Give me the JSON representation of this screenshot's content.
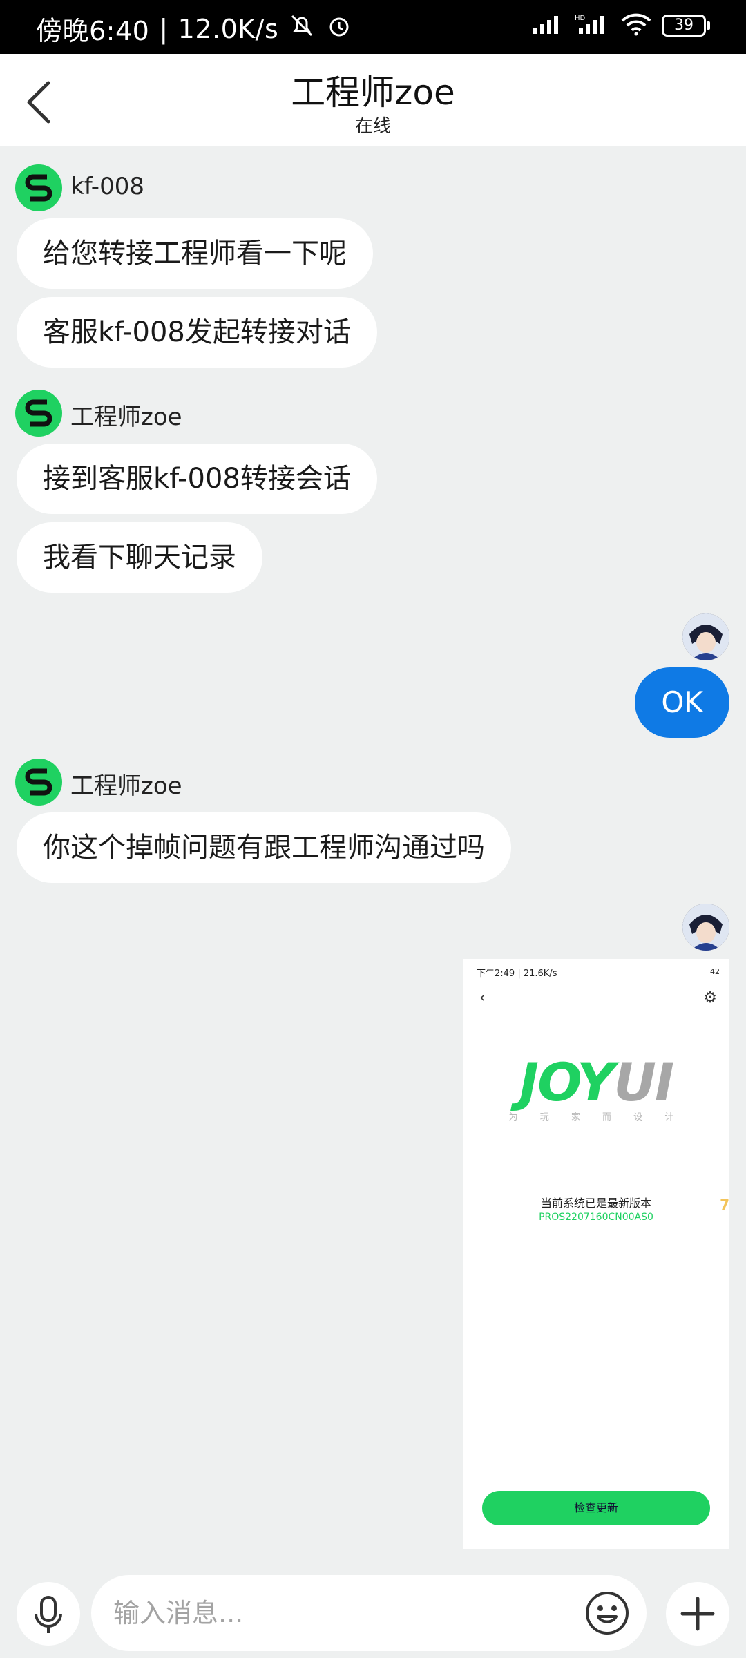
{
  "status_bar": {
    "time": "傍晚6:40",
    "net_speed": "12.0K/s",
    "battery": "39"
  },
  "header": {
    "title": "工程师zoe",
    "status": "在线"
  },
  "messages": [
    {
      "sender": "kf-008",
      "text": "给您转接工程师看一下呢"
    },
    {
      "text": "客服kf-008发起转接对话"
    },
    {
      "sender": "工程师zoe",
      "text": "接到客服kf-008转接会话"
    },
    {
      "text": "我看下聊天记录"
    },
    {
      "text": "OK"
    },
    {
      "sender": "工程师zoe",
      "text": "你这个掉帧问题有跟工程师沟通过吗"
    }
  ],
  "shared_screenshot": {
    "status_left": "下午2:49 | 21.6K/s",
    "battery": "42",
    "logo_part1": "JOY",
    "logo_part2": "UI",
    "tagline": "为 玩 家 而 设 计",
    "message": "当前系统已是最新版本",
    "version": "PROS2207160CN00AS0",
    "check_update_button": "检查更新"
  },
  "input": {
    "placeholder": "输入消息..."
  }
}
